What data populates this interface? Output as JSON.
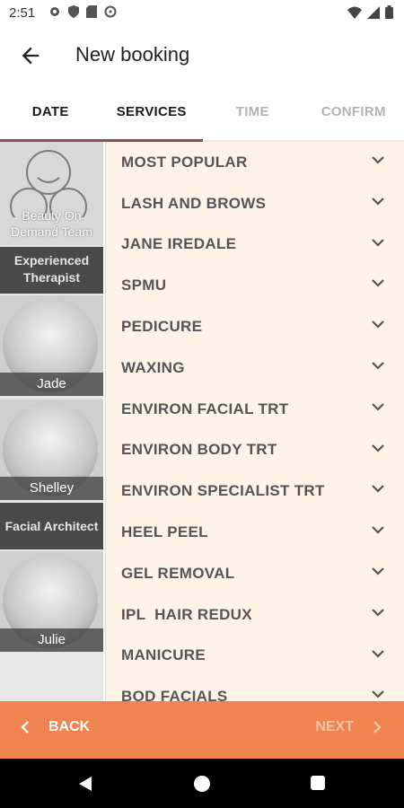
{
  "status_bar": {
    "time": "2:51",
    "icons_left": [
      "gear-icon",
      "shield-icon",
      "sd-card-icon",
      "data-saver-icon"
    ],
    "icons_right": [
      "wifi-icon",
      "signal-icon",
      "battery-icon"
    ]
  },
  "app_bar": {
    "title": "New booking",
    "back_icon": "arrow-left-icon"
  },
  "tabs": [
    {
      "label": "DATE",
      "state": "enabled"
    },
    {
      "label": "SERVICES",
      "state": "selected"
    },
    {
      "label": "TIME",
      "state": "disabled"
    },
    {
      "label": "CONFIRM",
      "state": "disabled"
    }
  ],
  "sidebar": {
    "team": {
      "label": "Beauty On Demand Team"
    },
    "sections": [
      {
        "label": "Experienced Therapist"
      },
      {
        "label": "Facial Architect"
      }
    ],
    "therapists": [
      {
        "name": "Jade"
      },
      {
        "name": "Shelley"
      },
      {
        "name": "Julie"
      }
    ]
  },
  "services": [
    "MOST POPULAR",
    "LASH AND BROWS",
    "JANE IREDALE",
    "SPMU",
    "PEDICURE",
    "WAXING",
    "ENVIRON FACIAL TRT",
    "ENVIRON BODY TRT",
    "ENVIRON SPECIALIST TRT",
    "HEEL PEEL",
    "GEL REMOVAL",
    "IPL  HAIR REDUX",
    "MANICURE",
    "BOD FACIALS"
  ],
  "bottom_bar": {
    "back_label": "BACK",
    "next_label": "NEXT"
  },
  "colors": {
    "accent": "#ef8451",
    "tab_indicator": "#8e4a5b",
    "services_bg": "#fdf3e7"
  }
}
